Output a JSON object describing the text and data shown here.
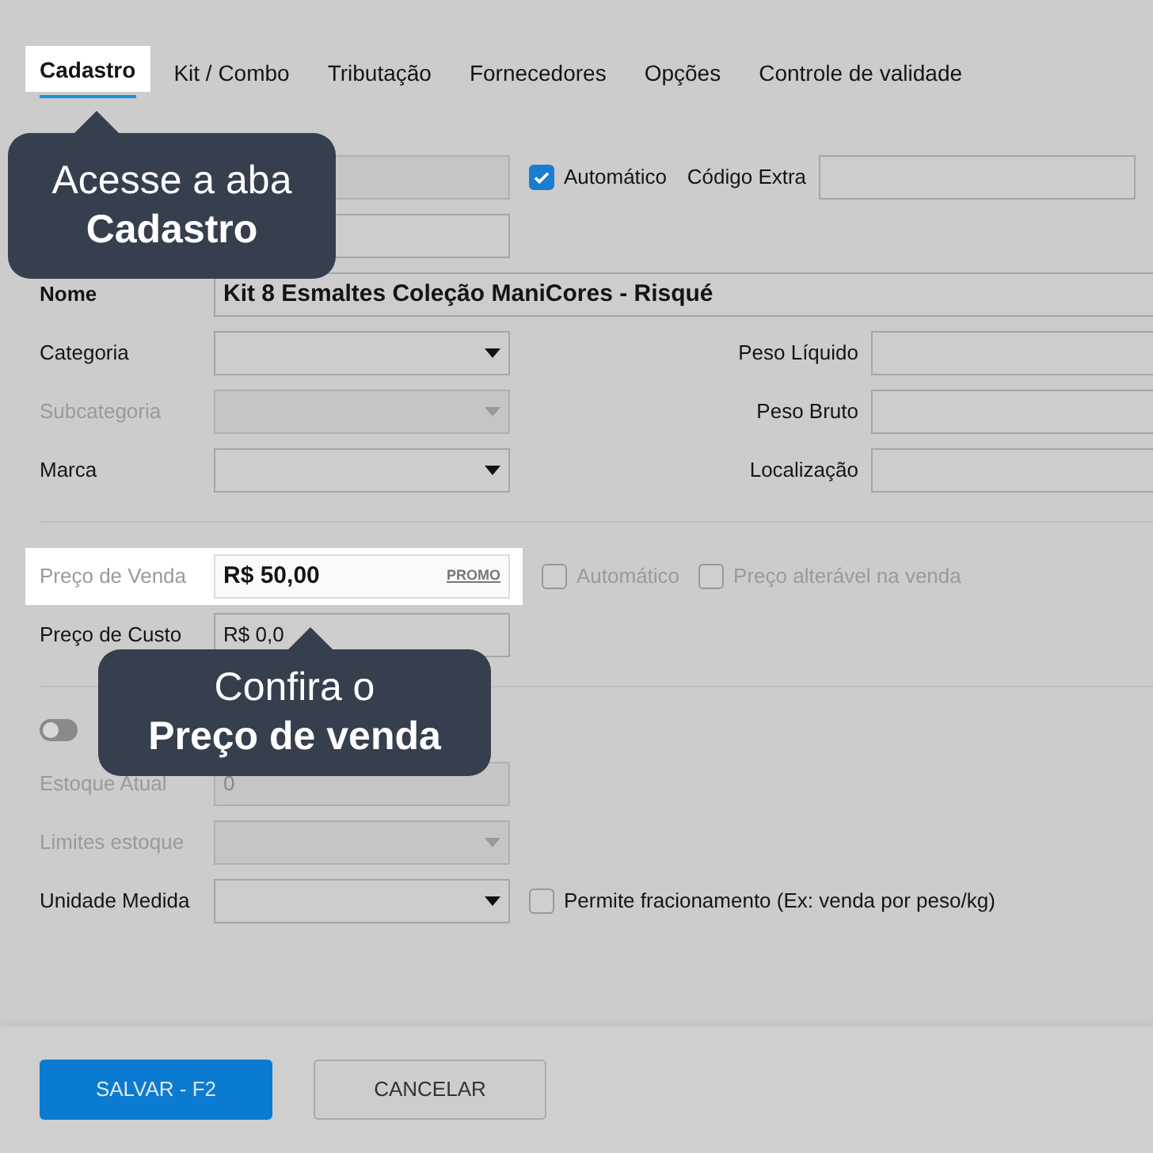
{
  "tabs": [
    {
      "label": "Cadastro",
      "selected": true
    },
    {
      "label": "Kit / Combo",
      "selected": false
    },
    {
      "label": "Tributação",
      "selected": false
    },
    {
      "label": "Fornecedores",
      "selected": false
    },
    {
      "label": "Opções",
      "selected": false
    },
    {
      "label": "Controle de validade",
      "selected": false
    }
  ],
  "codigo": {
    "auto_checkbox": {
      "label": "Automático",
      "checked": true
    },
    "extra_label": "Código Extra"
  },
  "nome": {
    "label": "Nome",
    "value": "Kit 8 Esmaltes Coleção ManiCores - Risqué"
  },
  "left_rows": [
    {
      "label": "Categoria",
      "disabled": false
    },
    {
      "label": "Subcategoria",
      "disabled": true
    },
    {
      "label": "Marca",
      "disabled": false
    }
  ],
  "right_fields": [
    "Peso Líquido",
    "Peso Bruto",
    "Localização"
  ],
  "preco_venda": {
    "label": "Preço de Venda",
    "value": "R$ 50,00",
    "tag": "PROMO",
    "highlighted": true
  },
  "preco_checks": [
    {
      "label": "Automático",
      "checked": false
    },
    {
      "label": "Preço alterável na venda",
      "checked": false
    }
  ],
  "preco_custo": {
    "label": "Preço de Custo",
    "value": "R$ 0,0"
  },
  "toggle": {
    "on": false
  },
  "estoque_rows": [
    {
      "kind": "text",
      "label": "Estoque Atual",
      "value": "0",
      "disabled": true
    },
    {
      "kind": "select",
      "label": "Limites estoque",
      "disabled": true
    },
    {
      "kind": "select",
      "label": "Unidade Medida",
      "disabled": false,
      "checkbox": {
        "label": "Permite fracionamento (Ex: venda por peso/kg)",
        "checked": false
      }
    }
  ],
  "buttons": [
    {
      "label": "SALVAR - F2",
      "kind": "primary"
    },
    {
      "label": "CANCELAR",
      "kind": "secondary"
    }
  ],
  "callouts": [
    {
      "text": "Acesse a aba **Cadastro**"
    },
    {
      "text": "Confira o **Preço de venda**"
    }
  ]
}
